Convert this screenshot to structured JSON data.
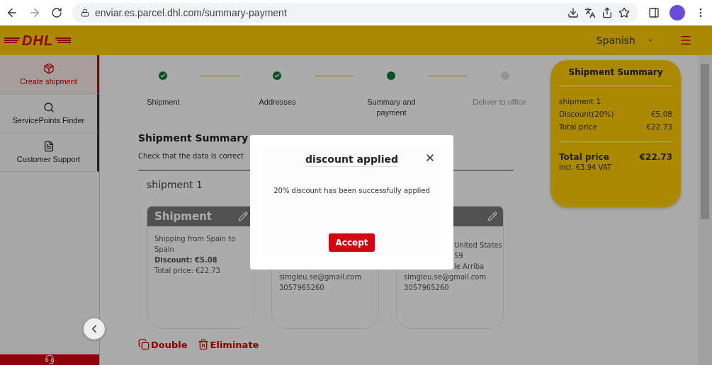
{
  "browser": {
    "url": "enviar.es.parcel.dhl.com/summary-payment"
  },
  "header": {
    "logo": "DHL",
    "language": "Spanish"
  },
  "sidebar": {
    "items": [
      {
        "label": "Create shipment",
        "selected": true
      },
      {
        "label": "ServicePoints Finder",
        "selected": false
      },
      {
        "label": "Customer Support",
        "selected": false
      }
    ]
  },
  "stepper": [
    {
      "label": "Shipment",
      "kind": "done"
    },
    {
      "label": "Addresses",
      "kind": "done"
    },
    {
      "label": "Summary and payment",
      "kind": "current"
    },
    {
      "label": "Deliver to office",
      "kind": "pending"
    }
  ],
  "summary_title": "Shipment Summary",
  "summary_hint": "Check that the data is correct",
  "shipment_label": "shipment 1",
  "cards": [
    {
      "kind": "shipment",
      "title": "Shipment",
      "lines": [
        {
          "text": "Shipping from Spain to Spain",
          "kind": "plain"
        },
        {
          "text": "Discount: €5.08",
          "kind": "bold"
        },
        {
          "text": "Total price: €22.73",
          "kind": "plain"
        }
      ]
    },
    {
      "kind": "address",
      "lines": [
        {
          "text": "simgleu.se@gmail.com",
          "kind": "plain"
        },
        {
          "text": "3057965260",
          "kind": "plain"
        }
      ]
    },
    {
      "kind": "address",
      "lines": [
        {
          "text": "United States",
          "kind": "clipped"
        },
        {
          "text": "59",
          "kind": "clipped"
        },
        {
          "text": "le Arriba",
          "kind": "clipped"
        },
        {
          "text": "simgleu.se@gmail.com",
          "kind": "plain"
        },
        {
          "text": "3057965260",
          "kind": "plain"
        }
      ]
    }
  ],
  "actions": [
    {
      "label": "Double"
    },
    {
      "label": "Eliminate"
    }
  ],
  "summary_panel": {
    "title": "Shipment Summary",
    "shipment": "shipment 1",
    "rows": [
      {
        "label": "Discount(20%)",
        "value": "€5.08"
      },
      {
        "label": "Total price",
        "value": "€22.73"
      }
    ],
    "total_label": "Total price",
    "total_value": "€22.73",
    "vat": "incl. €3.94 VAT"
  },
  "dialog": {
    "title": "discount applied",
    "message": "20% discount has been successfully applied",
    "button": "Accept"
  }
}
